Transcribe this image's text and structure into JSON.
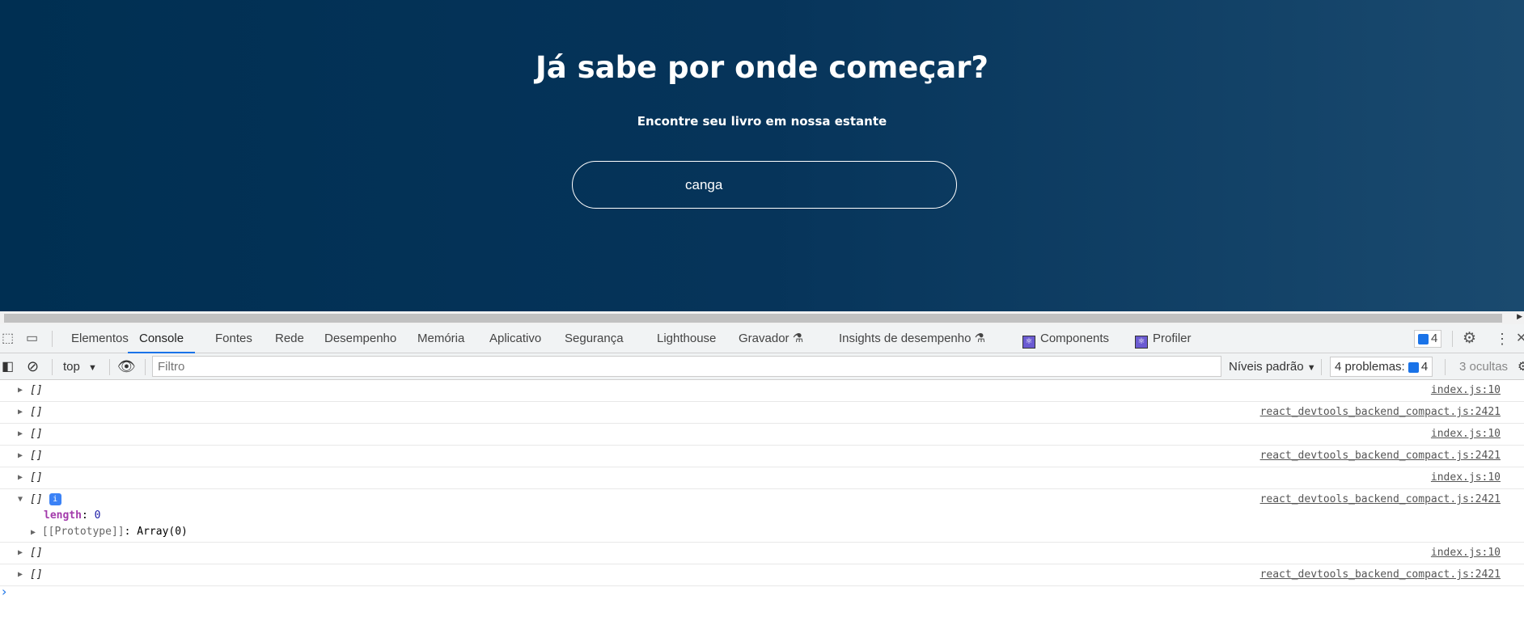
{
  "hero": {
    "title": "Já sabe por onde começar?",
    "subtitle": "Encontre seu livro em nossa estante",
    "search_value": "canga"
  },
  "devtools": {
    "tabs": [
      {
        "label": "Elementos"
      },
      {
        "label": "Console"
      },
      {
        "label": "Fontes"
      },
      {
        "label": "Rede"
      },
      {
        "label": "Desempenho"
      },
      {
        "label": "Memória"
      },
      {
        "label": "Aplicativo"
      },
      {
        "label": "Segurança"
      },
      {
        "label": "Lighthouse"
      },
      {
        "label": "Gravador"
      },
      {
        "label": "Insights de desempenho"
      },
      {
        "label": "Components"
      },
      {
        "label": "Profiler"
      }
    ],
    "active_tab": "Console",
    "issues_count": "4",
    "context": "top",
    "filter_placeholder": "Filtro",
    "levels": "Níveis padrão",
    "problems_label": "4 problemas:",
    "problems_count": "4",
    "hidden": "3 ocultas"
  },
  "console": {
    "rows": [
      {
        "value": "[]",
        "source": "index.js:10"
      },
      {
        "value": "[]",
        "source": "react_devtools_backend_compact.js:2421"
      },
      {
        "value": "[]",
        "source": "index.js:10"
      },
      {
        "value": "[]",
        "source": "react_devtools_backend_compact.js:2421"
      },
      {
        "value": "[]",
        "source": "index.js:10"
      },
      {
        "value": "[]",
        "source": "react_devtools_backend_compact.js:2421",
        "expanded": true,
        "length_key": "length",
        "length_value": "0",
        "prototype": "[[Prototype]]",
        "prototype_value": "Array(0)"
      },
      {
        "value": "[]",
        "source": "index.js:10"
      },
      {
        "value": "[]",
        "source": "react_devtools_backend_compact.js:2421"
      }
    ],
    "prompt": "›"
  }
}
